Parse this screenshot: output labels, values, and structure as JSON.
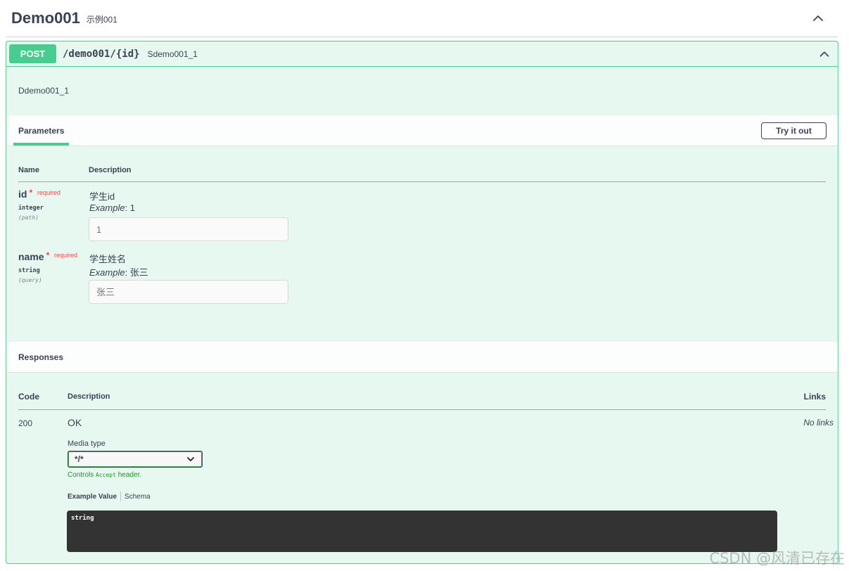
{
  "tag": {
    "name": "Demo001",
    "description": "示例001"
  },
  "operation": {
    "method": "POST",
    "path": "/demo001/{id}",
    "summary": "Sdemo001_1",
    "description": "Ddemo001_1",
    "method_color": "#49cc90"
  },
  "parameters": {
    "title": "Parameters",
    "try_button": "Try it out",
    "col_name": "Name",
    "col_description": "Description",
    "items": [
      {
        "name": "id",
        "star": "*",
        "required": "required",
        "type": "integer",
        "in": "(path)",
        "description": "学生id",
        "example_label": "Example",
        "example_value": ": 1",
        "input_placeholder": "1"
      },
      {
        "name": "name",
        "star": "*",
        "required": "required",
        "type": "string",
        "in": "(query)",
        "description": "学生姓名",
        "example_label": "Example",
        "example_value": ": 张三",
        "input_placeholder": "张三"
      }
    ]
  },
  "responses": {
    "title": "Responses",
    "col_code": "Code",
    "col_description": "Description",
    "col_links": "Links",
    "items": [
      {
        "code": "200",
        "description": "OK",
        "links": "No links",
        "media_type_label": "Media type",
        "media_type": "*/*",
        "controls_prefix": "Controls",
        "controls_code": "Accept",
        "controls_suffix": "header.",
        "example_tab": "Example Value",
        "schema_tab": "Schema",
        "example_value": "string"
      }
    ]
  },
  "watermark": "CSDN @风清已存在",
  "icons": {
    "collapse": "chevron-up-icon",
    "select": "chevron-down-icon"
  }
}
